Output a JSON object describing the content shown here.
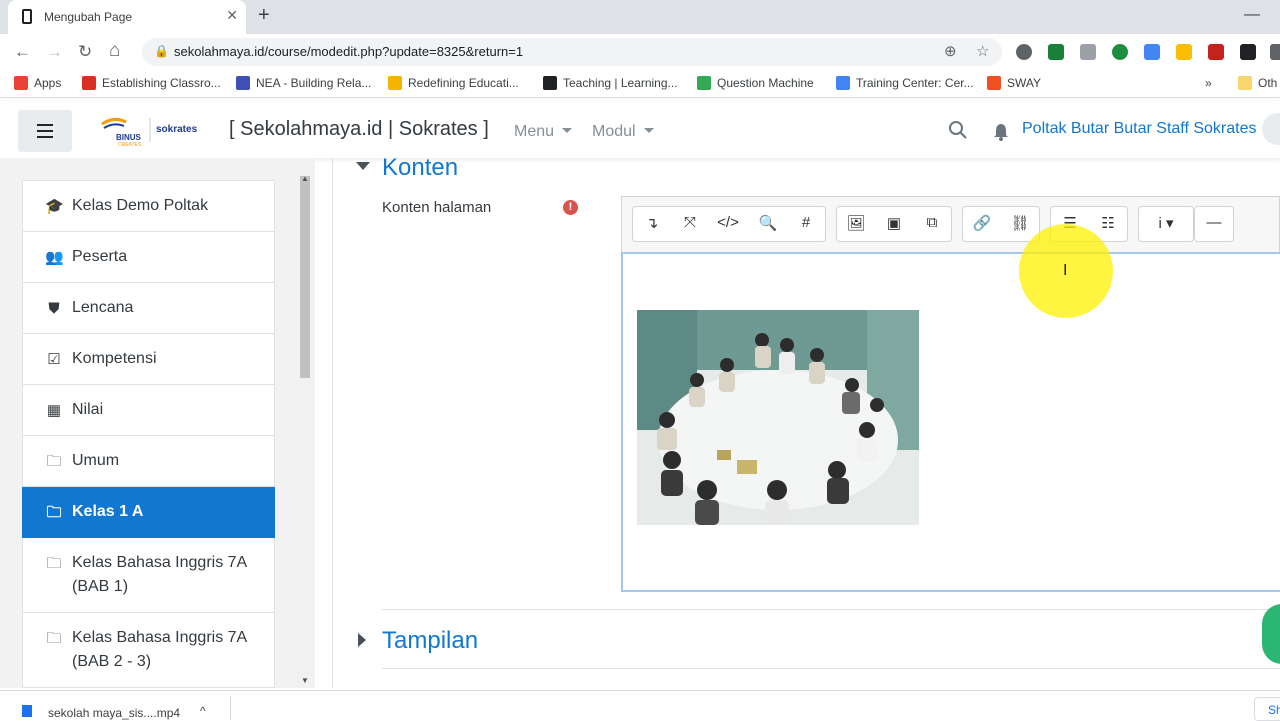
{
  "browser": {
    "tab_title": "Mengubah Page",
    "tab_close": "✕",
    "new_tab": "+",
    "minimize": "—",
    "url": "sekolahmaya.id/course/modedit.php?update=8325&return=1",
    "nav": {
      "back": "←",
      "forward": "→",
      "reload": "↻",
      "home": "⌂"
    },
    "bookmarks": [
      {
        "label": "Apps",
        "color": "#ea4335"
      },
      {
        "label": "Establishing Classro...",
        "color": "#d93025"
      },
      {
        "label": "NEA - Building Rela...",
        "color": "#3f51b5"
      },
      {
        "label": "Redefining Educati...",
        "color": "#f4b400"
      },
      {
        "label": "Teaching | Learning...",
        "color": "#202124"
      },
      {
        "label": "Question Machine",
        "color": "#34a853"
      },
      {
        "label": "Training Center: Cer...",
        "color": "#4285f4"
      },
      {
        "label": "SWAY",
        "color": "#f25022"
      },
      {
        "label": "Oth",
        "color": "#f9d56e"
      }
    ],
    "bookmarks_more": "»",
    "download_file": "sekolah maya_sis....mp4",
    "download_caret": "^",
    "show_all": "Sh"
  },
  "header": {
    "site_name": "[ Sekolahmaya.id | Sokrates ]",
    "menu_label": "Menu",
    "modul_label": "Modul",
    "user_name": "Poltak Butar Butar Staff Sokrates",
    "logo_text_1": "BINUS",
    "logo_text_2": "CREATES",
    "logo_text_3": "sokrates"
  },
  "sidebar": {
    "items": [
      {
        "label": "Kelas Demo Poltak",
        "icon": "graduation-cap-icon",
        "glyph": "🎓"
      },
      {
        "label": "Peserta",
        "icon": "users-icon",
        "glyph": "👥"
      },
      {
        "label": "Lencana",
        "icon": "shield-icon",
        "glyph": "⛊"
      },
      {
        "label": "Kompetensi",
        "icon": "check-square-icon",
        "glyph": "☑"
      },
      {
        "label": "Nilai",
        "icon": "table-icon",
        "glyph": "▦"
      },
      {
        "label": "Umum",
        "icon": "folder-icon",
        "glyph": "🗀"
      },
      {
        "label": "Kelas 1 A",
        "icon": "folder-icon",
        "glyph": "🗀"
      },
      {
        "label": "Kelas Bahasa Inggris 7A (BAB 1)",
        "icon": "folder-icon",
        "glyph": "🗀"
      },
      {
        "label": "Kelas Bahasa Inggris 7A (BAB 2 - 3)",
        "icon": "folder-icon",
        "glyph": "🗀"
      }
    ]
  },
  "main": {
    "section_konten": "Konten",
    "field_label": "Konten halaman",
    "required_mark": "!",
    "section_tampilan": "Tampilan"
  },
  "editor": {
    "buttons": [
      {
        "name": "collapse",
        "glyph": "↴"
      },
      {
        "name": "fullscreen",
        "glyph": "⤧"
      },
      {
        "name": "html",
        "glyph": "</>"
      },
      {
        "name": "find",
        "glyph": "🔍"
      },
      {
        "name": "equation",
        "glyph": "#"
      },
      {
        "name": "image",
        "glyph": "🖼"
      },
      {
        "name": "media",
        "glyph": "▣"
      },
      {
        "name": "manage-files",
        "glyph": "⧉"
      },
      {
        "name": "link",
        "glyph": "🔗"
      },
      {
        "name": "unlink",
        "glyph": "⛓"
      },
      {
        "name": "unordered-list",
        "glyph": "☰"
      },
      {
        "name": "ordered-list",
        "glyph": "☷"
      },
      {
        "name": "info",
        "glyph": "i ▾"
      },
      {
        "name": "horizontal-rule",
        "glyph": "—"
      }
    ],
    "cursor": "I"
  },
  "colors": {
    "accent": "#1177d1",
    "required": "#d9534f",
    "cursor_highlight": "#fff200"
  }
}
